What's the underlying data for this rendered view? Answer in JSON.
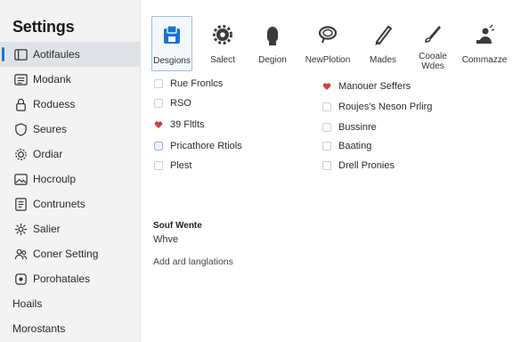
{
  "sidebar": {
    "title": "Settings",
    "items": [
      {
        "label": "Aotifaules",
        "icon": "panel-icon",
        "active": true
      },
      {
        "label": "Modank",
        "icon": "list-icon"
      },
      {
        "label": "Roduess",
        "icon": "lock-icon"
      },
      {
        "label": "Seures",
        "icon": "shield-icon"
      },
      {
        "label": "Ordiar",
        "icon": "gear-icon"
      },
      {
        "label": "Hocroulp",
        "icon": "image-icon"
      },
      {
        "label": "Contrunets",
        "icon": "document-icon"
      },
      {
        "label": "Salier",
        "icon": "cog-icon"
      },
      {
        "label": "Coner Setting",
        "icon": "people-icon"
      },
      {
        "label": "Porohatales",
        "icon": "folder-icon"
      },
      {
        "label": "Hoails",
        "icon": ""
      },
      {
        "label": "Morostants",
        "icon": ""
      }
    ]
  },
  "toolbar": {
    "items": [
      {
        "label": "Desgions",
        "icon": "save-icon",
        "active": true
      },
      {
        "label": "Salect",
        "icon": "gear-icon"
      },
      {
        "label": "Degion",
        "icon": "user-head-icon"
      },
      {
        "label": "NewPlotion",
        "icon": "pin-icon"
      },
      {
        "label": "Mades",
        "icon": "pen-icon"
      },
      {
        "label": "Cooale\nWdes",
        "icon": "brush-icon"
      },
      {
        "label": "Commazze",
        "icon": "people-icon"
      }
    ]
  },
  "options": {
    "left": [
      {
        "label": "Rue Fronlcs",
        "mark": "none"
      },
      {
        "label": "RSO",
        "mark": "none"
      },
      {
        "label": "39 Fltlts",
        "mark": "heart"
      },
      {
        "label": "Pricathore Rtiols",
        "mark": "blue"
      },
      {
        "label": "Plest",
        "mark": "none"
      }
    ],
    "right": [
      {
        "label": "Manouer Seffers",
        "mark": "heart"
      },
      {
        "label": "Roujes's Neson Prlirg",
        "mark": "none"
      },
      {
        "label": "Bussinre",
        "mark": "none"
      },
      {
        "label": "Baating",
        "mark": "none"
      },
      {
        "label": "Drell Pronies",
        "mark": "none"
      }
    ]
  },
  "section": {
    "title": "Souf Wente",
    "subtitle": "Whve",
    "link": "Add ard langlations"
  },
  "colors": {
    "accent": "#1a73d1",
    "heart": "#d2403a",
    "sidebar_bg": "#f3f3f3"
  }
}
